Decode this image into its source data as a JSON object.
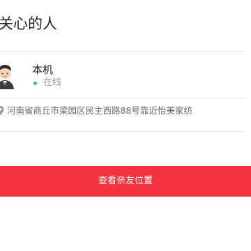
{
  "page": {
    "title": "关心的人"
  },
  "contact": {
    "avatar_icon": "person-avatar-icon",
    "name": "本机",
    "status": "在线",
    "status_color": "#2ec56b",
    "location_icon": "location-pin-icon",
    "address": "河南省商丘市梁园区民主西路88号靠近怡美家纺"
  },
  "actions": {
    "view_location_label": "查看亲友位置",
    "button_color": "#f5323f"
  }
}
